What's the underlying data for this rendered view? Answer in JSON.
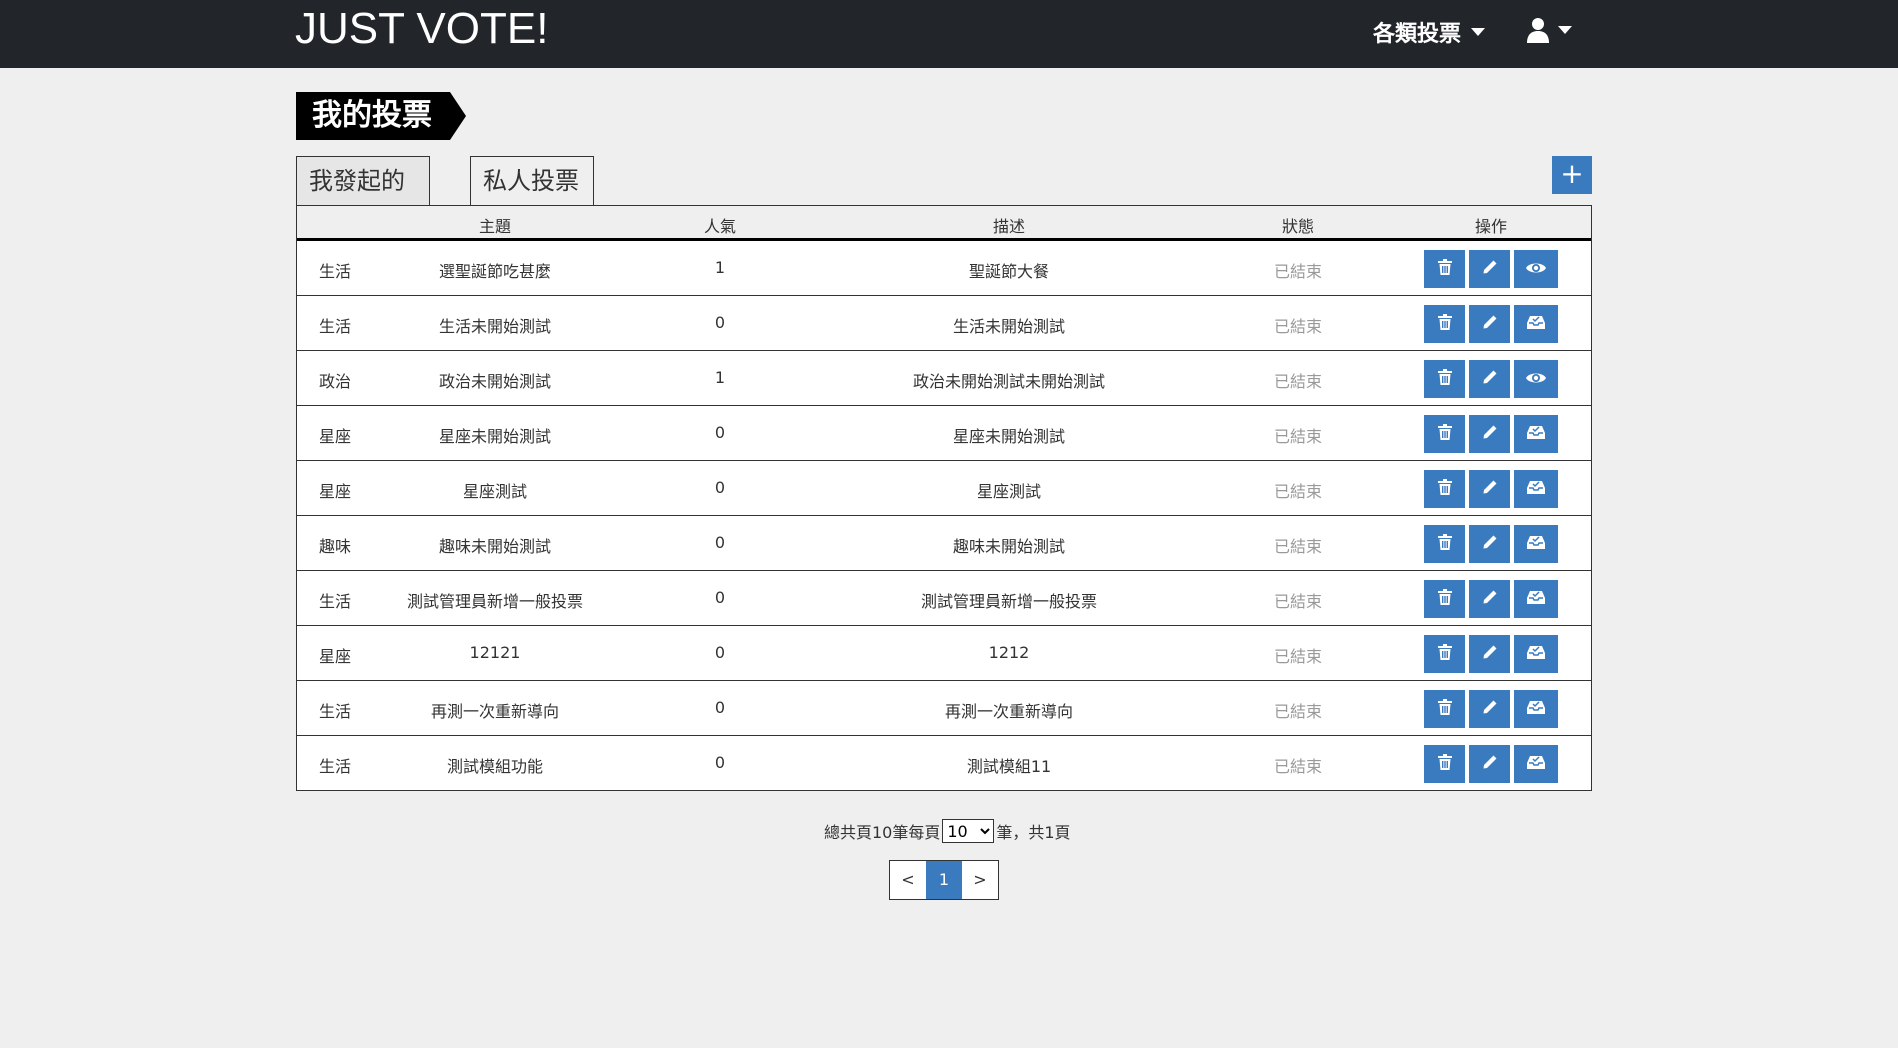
{
  "header": {
    "brand": "JUST VOTE!",
    "nav_vote_label": "各類投票"
  },
  "page_title": "我的投票",
  "tabs": [
    {
      "label": "我發起的投票"
    },
    {
      "label": "私人投票"
    }
  ],
  "add_button": "+",
  "table": {
    "headers": {
      "topic": "主題",
      "popularity": "人氣",
      "description": "描述",
      "status": "狀態",
      "actions": "操作"
    },
    "rows": [
      {
        "category": "生活",
        "topic": "選聖誕節吃甚麼",
        "popularity": "1",
        "description": "聖誕節大餐",
        "status": "已結束",
        "third_icon": "eye-icon"
      },
      {
        "category": "生活",
        "topic": "生活未開始測試",
        "popularity": "0",
        "description": "生活未開始測試",
        "status": "已結束",
        "third_icon": "inbox-icon"
      },
      {
        "category": "政治",
        "topic": "政治未開始測試",
        "popularity": "1",
        "description": "政治未開始測試未開始測試",
        "status": "已結束",
        "third_icon": "eye-icon"
      },
      {
        "category": "星座",
        "topic": "星座未開始測試",
        "popularity": "0",
        "description": "星座未開始測試",
        "status": "已結束",
        "third_icon": "inbox-icon"
      },
      {
        "category": "星座",
        "topic": "星座測試",
        "popularity": "0",
        "description": "星座測試",
        "status": "已結束",
        "third_icon": "inbox-icon"
      },
      {
        "category": "趣味",
        "topic": "趣味未開始測試",
        "popularity": "0",
        "description": "趣味未開始測試",
        "status": "已結束",
        "third_icon": "inbox-icon"
      },
      {
        "category": "生活",
        "topic": "測試管理員新增一般投票",
        "popularity": "0",
        "description": "測試管理員新增一般投票",
        "status": "已結束",
        "third_icon": "inbox-icon"
      },
      {
        "category": "星座",
        "topic": "12121",
        "popularity": "0",
        "description": "1212",
        "status": "已結束",
        "third_icon": "inbox-icon"
      },
      {
        "category": "生活",
        "topic": "再測一次重新導向",
        "popularity": "0",
        "description": "再測一次重新導向",
        "status": "已結束",
        "third_icon": "inbox-icon"
      },
      {
        "category": "生活",
        "topic": "測試模組功能",
        "popularity": "0",
        "description": "測試模組11",
        "status": "已結束",
        "third_icon": "inbox-icon"
      }
    ]
  },
  "pager": {
    "prefix": "總共頁10筆每頁",
    "per_page": "10",
    "suffix": "筆，共1頁",
    "prev": "<",
    "current": "1",
    "next": ">"
  },
  "colors": {
    "accent": "#3a7bbf",
    "topbar": "#222529",
    "status": "#999999"
  }
}
